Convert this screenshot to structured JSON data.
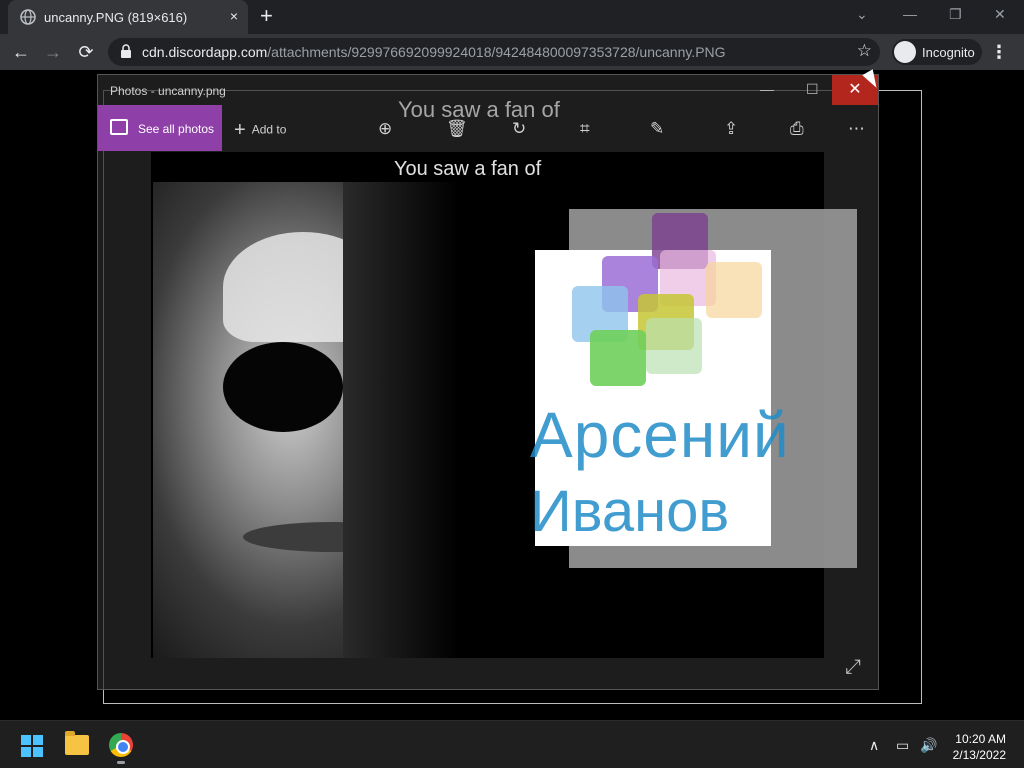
{
  "browser": {
    "tab_title": "uncanny.PNG (819×616)",
    "tab_close": "×",
    "new_tab": "+",
    "url_host": "cdn.discordapp.com",
    "url_path": "/attachments/929976692099924018/942484800097353728/uncanny.PNG",
    "incognito_label": "Incognito",
    "back": "←",
    "forward": "→",
    "reload": "⟳",
    "star": "☆",
    "menu": "⋮",
    "win_chevron": "⌄",
    "win_min": "—",
    "win_max": "❐",
    "win_close": "✕"
  },
  "photos_window": {
    "title": "Photos - uncanny.png",
    "see_all_label": "See all photos",
    "add_to_label": "Add to",
    "ghost_caption": "You saw a fan of",
    "min": "—",
    "max": "☐",
    "close": "✕",
    "tools": [
      "zoom-in-icon",
      "delete-icon",
      "rotate-icon",
      "crop-icon",
      "edit-icon",
      "share-icon",
      "print-icon",
      "more-icon"
    ],
    "tool_glyphs": [
      "⊕",
      "🗑",
      "↻",
      "⌗",
      "✎",
      "⇪",
      "⎙",
      "⋯"
    ]
  },
  "meme": {
    "caption": "You saw a fan of",
    "name_line1": "Арсений",
    "name_line2": "Иванов"
  },
  "expand_glyph": "⤢",
  "taskbar": {
    "time": "10:20 AM",
    "date": "2/13/2022",
    "chevron": "∧",
    "network": "▭",
    "volume": "🔊"
  }
}
